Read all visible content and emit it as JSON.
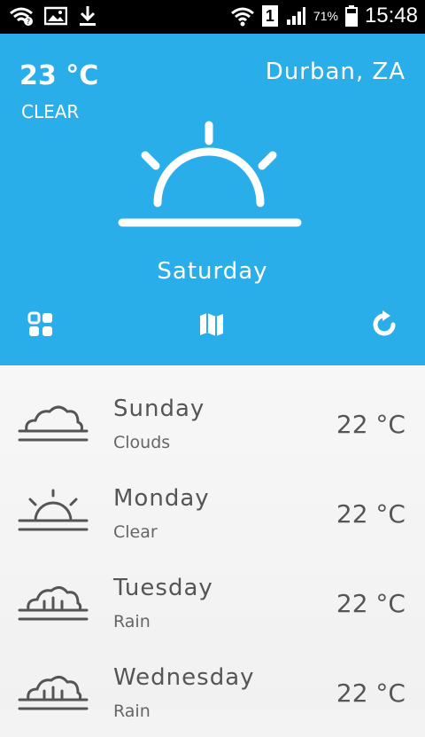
{
  "status_bar": {
    "battery_percent": "71%",
    "time": "15:48",
    "sim_slot": "1"
  },
  "current": {
    "temperature": "23 °C",
    "condition": "CLEAR",
    "location": "Durban, ZA",
    "day": "Saturday",
    "icon": "sunrise-icon"
  },
  "toolbar": {
    "left_icon": "grid-icon",
    "center_icon": "map-icon",
    "right_icon": "refresh-icon"
  },
  "forecast": [
    {
      "day": "Sunday",
      "desc": "Clouds",
      "temp": "22 °C",
      "icon": "cloud-icon"
    },
    {
      "day": "Monday",
      "desc": "Clear",
      "temp": "22 °C",
      "icon": "sun-icon"
    },
    {
      "day": "Tuesday",
      "desc": "Rain",
      "temp": "22 °C",
      "icon": "rain-icon"
    },
    {
      "day": "Wednesday",
      "desc": "Rain",
      "temp": "22 °C",
      "icon": "rain-icon"
    }
  ],
  "colors": {
    "header_bg": "#2aaee9",
    "text_on_header": "#ffffff",
    "list_text": "#555555"
  }
}
